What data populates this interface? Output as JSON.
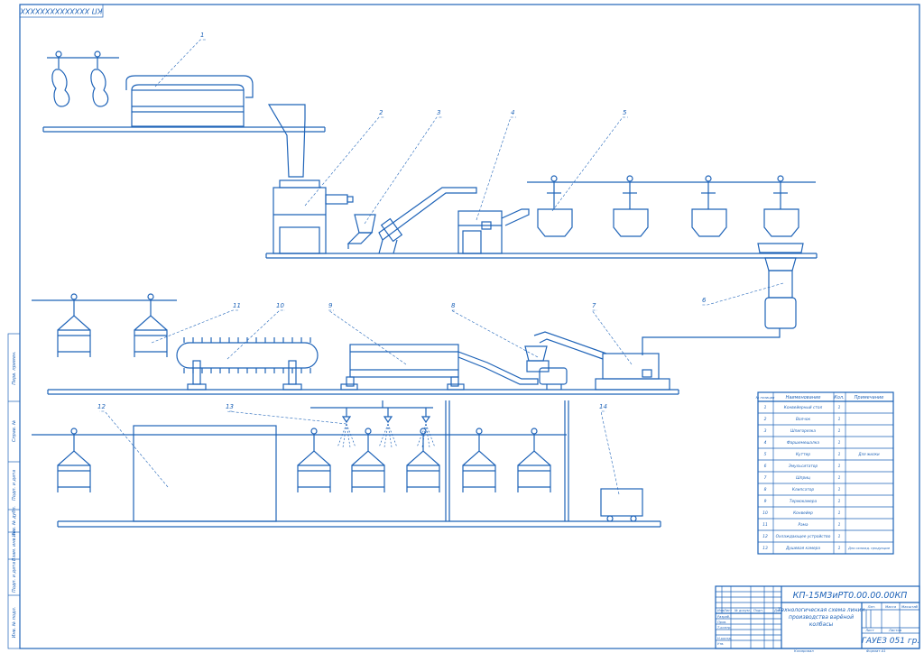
{
  "doc_code_rotated": "КП ХХХХХХХХХХХХХХ",
  "callouts": [
    "1",
    "2",
    "3",
    "4",
    "5",
    "6",
    "7",
    "8",
    "9",
    "10",
    "11",
    "12",
    "13",
    "14"
  ],
  "side_stamp": [
    "Перв. примен.",
    "Справ. №",
    "Подп. и дата",
    "Инв. № дубл.",
    "Взам. инв. №",
    "Подп. и дата",
    "Инв. № подл."
  ],
  "table": {
    "headers": [
      "№ позиции",
      "Наименование",
      "Кол.",
      "Примечание"
    ],
    "rows": [
      [
        "1",
        "Конвейерный стол",
        "1",
        ""
      ],
      [
        "2",
        "Волчок",
        "1",
        ""
      ],
      [
        "3",
        "Шпигорезка",
        "1",
        ""
      ],
      [
        "4",
        "Фаршемешалка",
        "1",
        ""
      ],
      [
        "5",
        "Куттер",
        "1",
        "Для жилки"
      ],
      [
        "6",
        "Эмульситатор",
        "1",
        ""
      ],
      [
        "7",
        "Шприц",
        "1",
        ""
      ],
      [
        "8",
        "Клипсатор",
        "1",
        ""
      ],
      [
        "9",
        "Термокамера",
        "1",
        ""
      ],
      [
        "10",
        "Конвейер",
        "1",
        ""
      ],
      [
        "11",
        "Рама",
        "1",
        ""
      ],
      [
        "12",
        "Охлаждающее устройство",
        "1",
        ""
      ],
      [
        "13",
        "Душевая камера",
        "1",
        "Для охлажд. продукции"
      ]
    ]
  },
  "title_block": {
    "designation": "КП-15МЗиРТ0.00.00.00КП",
    "name_line1": "Технологическая схема линии",
    "name_line2": "производства варёной",
    "name_line3": "колбасы",
    "lit": "Лит.",
    "mass": "Масса",
    "scale": "Масштаб",
    "sheet": "Лист",
    "sheets": "Листов",
    "org": "ГАУЕЗ 051 гр.",
    "rows_left": [
      "Изм.",
      "Лист",
      "№ докум.",
      "Подп.",
      "Дата"
    ],
    "roles": [
      "Разраб.",
      "Пров.",
      "Т.контр.",
      "",
      "Н.контр.",
      "Утв."
    ],
    "copied": "Копировал",
    "format": "Формат   А1"
  }
}
